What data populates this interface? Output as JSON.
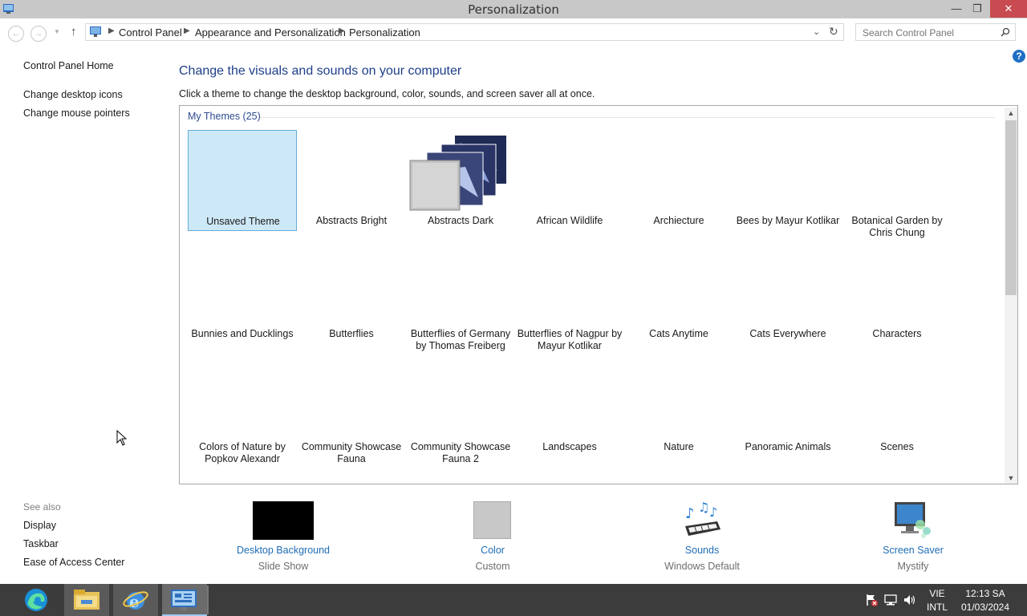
{
  "window": {
    "title": "Personalization",
    "min_glyph": "—",
    "max_glyph": "❐",
    "close_glyph": "✕"
  },
  "nav": {
    "back_glyph": "←",
    "forward_glyph": "→",
    "up_glyph": "↑",
    "breadcrumbs": [
      "Control Panel",
      "Appearance and Personalization",
      "Personalization"
    ],
    "search_placeholder": "Search Control Panel"
  },
  "sidebar": {
    "links": [
      "Control Panel Home",
      "Change desktop icons",
      "Change mouse pointers"
    ],
    "see_also_label": "See also",
    "see_also": [
      "Display",
      "Taskbar",
      "Ease of Access Center"
    ]
  },
  "main": {
    "heading": "Change the visuals and sounds on your computer",
    "subheading": "Click a theme to change the desktop background, color, sounds, and screen saver all at once.",
    "group_label": "My Themes (25)",
    "themes": [
      [
        "Unsaved Theme",
        "Abstracts Bright",
        "Abstracts Dark",
        "African Wildlife",
        "Archiecture",
        "Bees by Mayur Kotlikar",
        "Botanical Garden by Chris Chung"
      ],
      [
        "Bunnies and Ducklings",
        "Butterflies",
        "Butterflies of Germany by Thomas Freiberg",
        "Butterflies of Nagpur by Mayur Kotlikar",
        "Cats Anytime",
        "Cats Everywhere",
        "Characters"
      ],
      [
        "Colors of Nature by Popkov Alexandr",
        "Community Showcase Fauna",
        "Community Showcase Fauna 2",
        "Landscapes",
        "Nature",
        "Panoramic Animals",
        "Scenes"
      ]
    ]
  },
  "bottom": {
    "desktop_background": {
      "label": "Desktop Background",
      "value": "Slide Show"
    },
    "color": {
      "label": "Color",
      "value": "Custom"
    },
    "sounds": {
      "label": "Sounds",
      "value": "Windows Default"
    },
    "screen_saver": {
      "label": "Screen Saver",
      "value": "Mystify"
    }
  },
  "taskbar": {
    "lang": [
      "VIE",
      "INTL"
    ],
    "time": "12:13 SA",
    "date": "01/03/2024"
  },
  "colors": {
    "accent": "#1e3f8a",
    "link": "#1f6db5",
    "selection": "#cde8f7",
    "taskbar": "#3c3c3c"
  }
}
